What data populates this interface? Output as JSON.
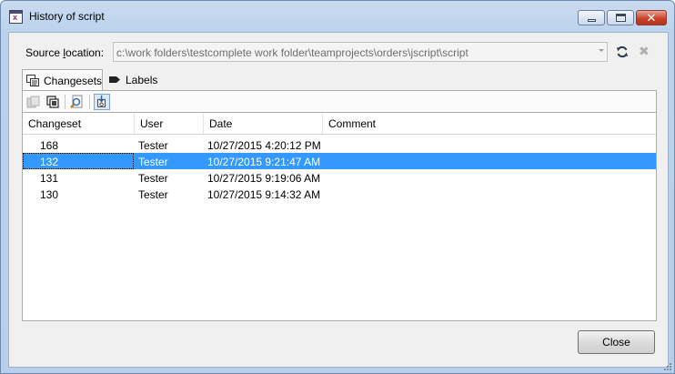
{
  "window": {
    "title": "History of script",
    "buttons": {
      "minimize": "minimize",
      "maximize": "maximize",
      "close": "✕"
    }
  },
  "source": {
    "label_prefix": "Source ",
    "label_accel": "l",
    "label_rest": "ocation:",
    "path": "c:\\work folders\\testcomplete work folder\\teamprojects\\orders\\jscript\\script",
    "icons": [
      "refresh-icon",
      "clear-icon"
    ]
  },
  "tabs": [
    {
      "label": "Changesets",
      "icon": "changesets-icon",
      "active": true
    },
    {
      "label": "Labels",
      "icon": "label-tag-icon",
      "active": false
    }
  ],
  "toolbar": {
    "icons": [
      "compare-icon",
      "view-changeset-icon",
      "find-icon",
      "get-version-icon"
    ]
  },
  "grid": {
    "columns": [
      "Changeset",
      "User",
      "Date",
      "Comment"
    ],
    "rows": [
      {
        "changeset": "168",
        "user": "Tester",
        "date": "10/27/2015 4:20:12 PM",
        "comment": ""
      },
      {
        "changeset": "132",
        "user": "Tester",
        "date": "10/27/2015 9:21:47 AM",
        "comment": "",
        "selected": true
      },
      {
        "changeset": "131",
        "user": "Tester",
        "date": "10/27/2015 9:19:06 AM",
        "comment": ""
      },
      {
        "changeset": "130",
        "user": "Tester",
        "date": "10/27/2015 9:14:32 AM",
        "comment": ""
      }
    ]
  },
  "footer": {
    "close_label": "Close"
  },
  "colors": {
    "selection": "#3399ff",
    "frame": "#bcd2ec"
  }
}
